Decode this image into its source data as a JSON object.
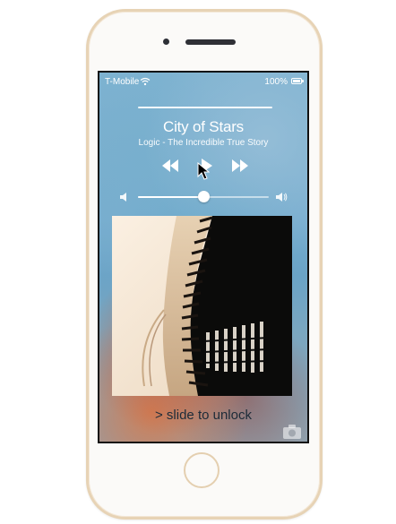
{
  "status_bar": {
    "carrier": "T-Mobile",
    "battery_text": "100%",
    "icons": {
      "signal": "wifi-icon",
      "battery": "battery-icon"
    }
  },
  "now_playing": {
    "title": "City of Stars",
    "subtitle": "Logic - The Incredible True Story",
    "controls": {
      "previous": "rewind-icon",
      "play": "play-icon",
      "next": "fast-forward-icon"
    },
    "volume": {
      "level": 0.5,
      "low_icon": "volume-low-icon",
      "high_icon": "volume-high-icon"
    }
  },
  "lock_screen": {
    "unlock_text": "> slide to unlock",
    "camera": "camera-icon"
  },
  "colors": {
    "phone_frame": "#e7d3b5",
    "text_dark": "#1c2b38",
    "accent": "#ffffff"
  }
}
